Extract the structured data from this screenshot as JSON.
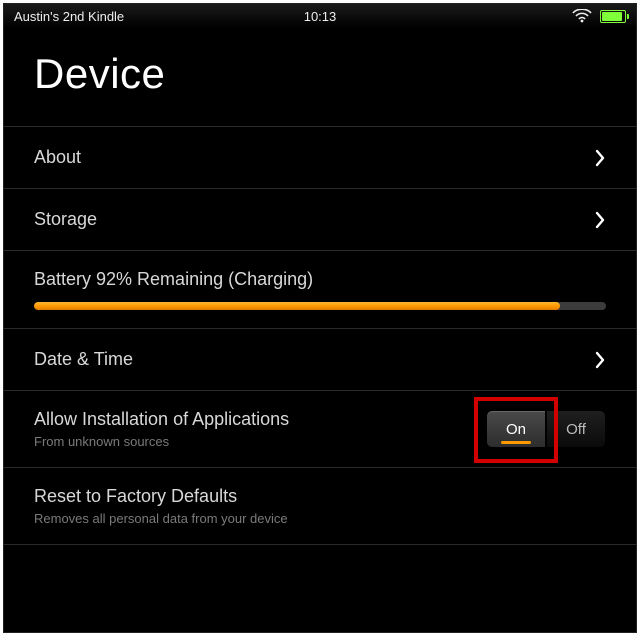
{
  "statusbar": {
    "device_name": "Austin's 2nd Kindle",
    "time": "10:13"
  },
  "battery_pct": 92,
  "page": {
    "title": "Device"
  },
  "rows": {
    "about": {
      "label": "About"
    },
    "storage": {
      "label": "Storage"
    },
    "battery": {
      "label": "Battery 92% Remaining (Charging)"
    },
    "datetime": {
      "label": "Date & Time"
    },
    "allow_install": {
      "label": "Allow Installation of Applications",
      "sub": "From unknown sources",
      "on": "On",
      "off": "Off",
      "value": "On"
    },
    "reset": {
      "label": "Reset to Factory Defaults",
      "sub": "Removes all personal data from your device"
    }
  },
  "highlight": {
    "target": "toggle-on-option"
  }
}
